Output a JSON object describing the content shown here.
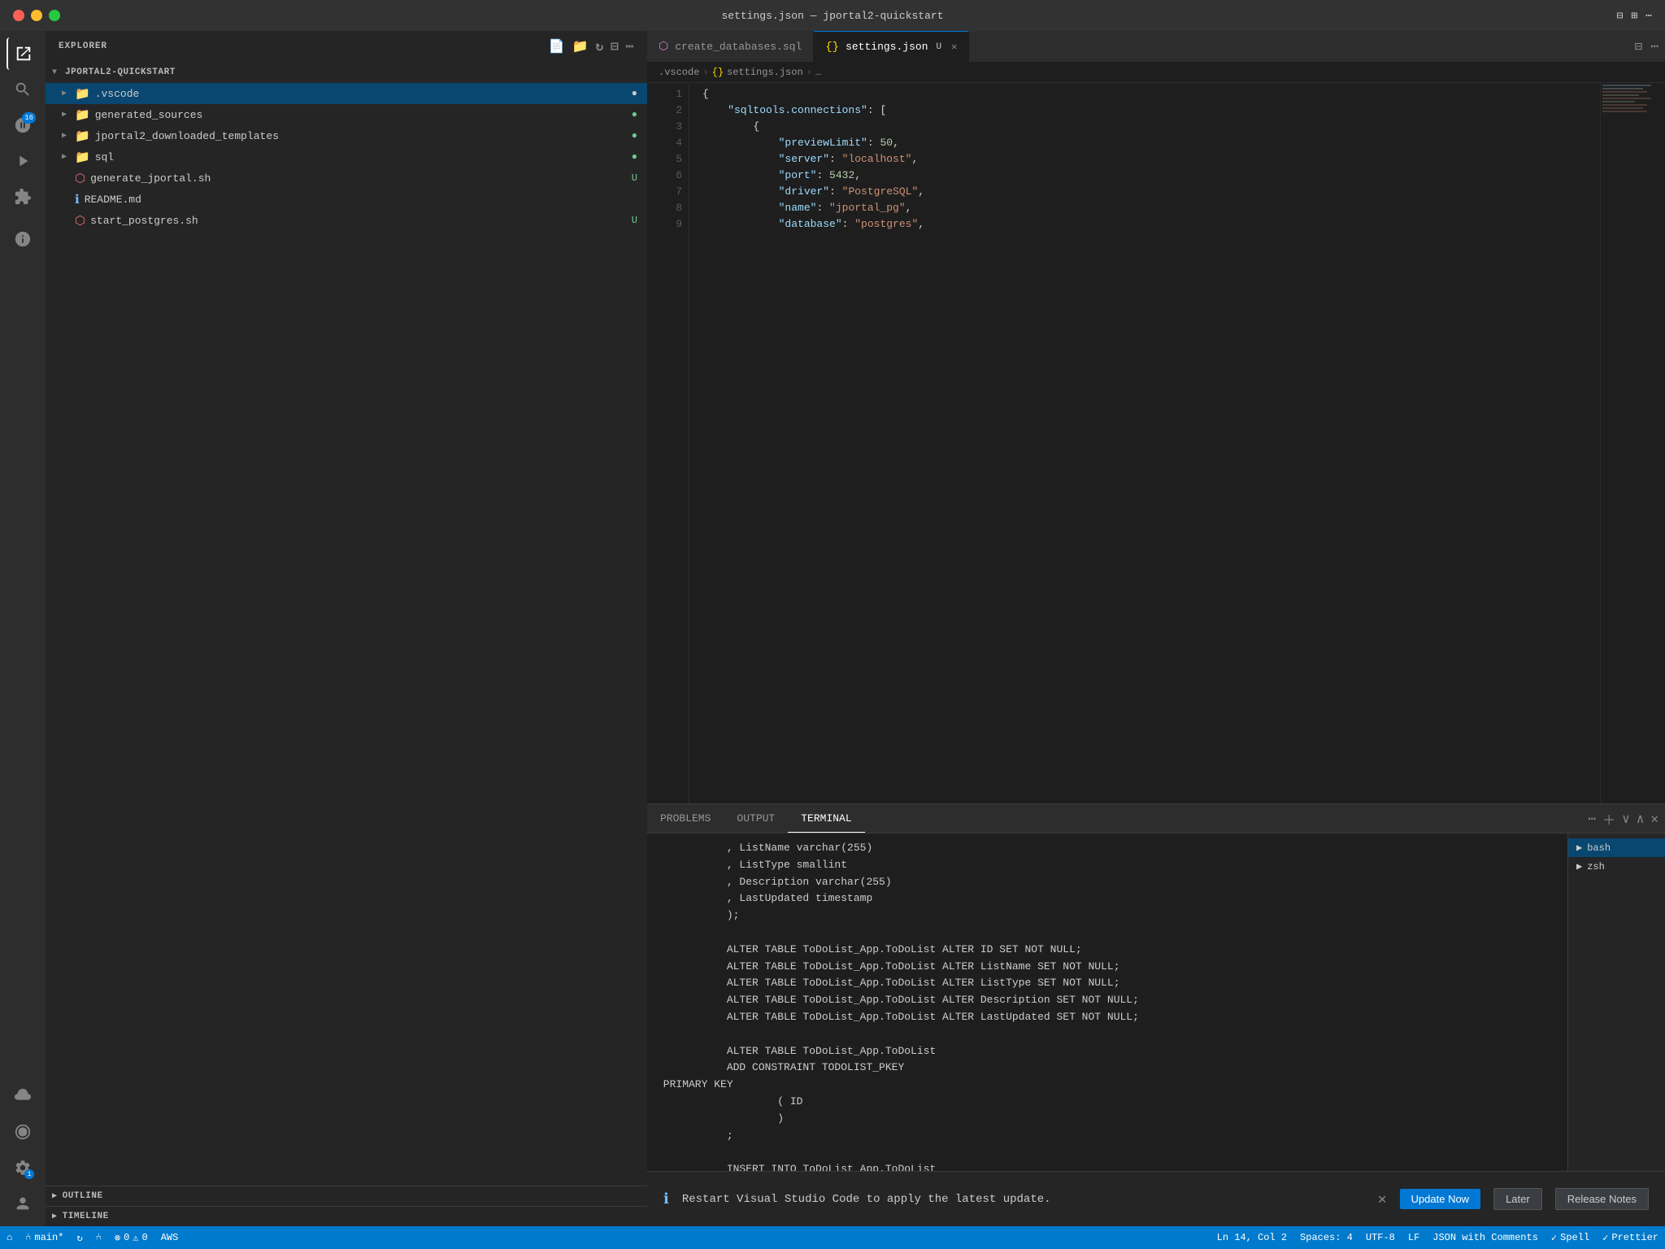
{
  "titlebar": {
    "title": "settings.json — jportal2-quickstart",
    "buttons": {
      "close": "●",
      "minimize": "●",
      "maximize": "●"
    }
  },
  "activity": {
    "icons": [
      {
        "name": "explorer",
        "symbol": "⎘",
        "active": true,
        "badge": null
      },
      {
        "name": "search",
        "symbol": "🔍",
        "active": false,
        "badge": null
      },
      {
        "name": "source-control",
        "symbol": "⑃",
        "active": false,
        "badge": "16"
      },
      {
        "name": "run",
        "symbol": "▷",
        "active": false,
        "badge": null
      },
      {
        "name": "extensions",
        "symbol": "⊞",
        "active": false,
        "badge": null
      }
    ],
    "bottom": [
      {
        "name": "remote",
        "symbol": "⌂"
      },
      {
        "name": "aws",
        "symbol": "☁"
      },
      {
        "name": "git-lens",
        "symbol": "◎"
      },
      {
        "name": "settings",
        "symbol": "⚙",
        "badge": "1"
      },
      {
        "name": "account",
        "symbol": "👤"
      }
    ]
  },
  "sidebar": {
    "header": "Explorer",
    "project": "JPORTAL2-QUICKSTART",
    "tree": [
      {
        "id": "vscode",
        "type": "folder",
        "name": ".vscode",
        "level": 0,
        "expanded": true,
        "selected": true,
        "status": "dot"
      },
      {
        "id": "generated_sources",
        "type": "folder",
        "name": "generated_sources",
        "level": 0,
        "expanded": false,
        "status": "green"
      },
      {
        "id": "jportal2",
        "type": "folder",
        "name": "jportal2_downloaded_templates",
        "level": 0,
        "expanded": false,
        "status": "green"
      },
      {
        "id": "sql",
        "type": "folder",
        "name": "sql",
        "level": 0,
        "expanded": false,
        "status": "green"
      },
      {
        "id": "generate",
        "type": "file",
        "name": "generate_jportal.sh",
        "level": 0,
        "status": "U",
        "fileIcon": "sh"
      },
      {
        "id": "readme",
        "type": "file",
        "name": "README.md",
        "level": 0,
        "status": "",
        "fileIcon": "md"
      },
      {
        "id": "start",
        "type": "file",
        "name": "start_postgres.sh",
        "level": 0,
        "status": "U",
        "fileIcon": "sh"
      }
    ],
    "outline": "OUTLINE",
    "timeline": "TIMELINE"
  },
  "tabs": [
    {
      "id": "create_db",
      "label": "create_databases.sql",
      "active": false,
      "modified": false,
      "icon": "sql"
    },
    {
      "id": "settings",
      "label": "settings.json",
      "active": true,
      "modified": true,
      "icon": "json"
    }
  ],
  "breadcrumb": {
    "path": [
      ".vscode",
      "settings.json",
      "..."
    ]
  },
  "editor": {
    "lines": [
      {
        "num": 1,
        "content": "{"
      },
      {
        "num": 2,
        "content": "    \"sqltools.connections\": ["
      },
      {
        "num": 3,
        "content": "        {"
      },
      {
        "num": 4,
        "content": "            \"previewLimit\": 50,"
      },
      {
        "num": 5,
        "content": "            \"server\": \"localhost\","
      },
      {
        "num": 6,
        "content": "            \"port\": 5432,"
      },
      {
        "num": 7,
        "content": "            \"driver\": \"PostgreSQL\","
      },
      {
        "num": 8,
        "content": "            \"name\": \"jportal_pg\","
      },
      {
        "num": 9,
        "content": "            \"database\": \"postgres\","
      }
    ]
  },
  "terminal": {
    "tabs": [
      "PROBLEMS",
      "OUTPUT",
      "TERMINAL"
    ],
    "active_tab": "TERMINAL",
    "shells": [
      "bash",
      "zsh"
    ],
    "active_shell": "bash",
    "content": [
      "           , ListName varchar(255)",
      "           , ListType smallint",
      "           , Description varchar(255)",
      "           , LastUpdated timestamp",
      "           );",
      "",
      "           ALTER TABLE ToDoList_App.ToDoList ALTER ID SET NOT NULL;",
      "           ALTER TABLE ToDoList_App.ToDoList ALTER ListName SET NOT NULL;",
      "           ALTER TABLE ToDoList_App.ToDoList ALTER ListType SET NOT NULL;",
      "           ALTER TABLE ToDoList_App.ToDoList ALTER Description SET NOT NULL;",
      "           ALTER TABLE ToDoList_App.ToDoList ALTER LastUpdated SET NOT NULL;",
      "",
      "           ALTER TABLE ToDoList_App.ToDoList",
      "           ADD CONSTRAINT TODOLIST_PKEY",
      " PRIMARY KEY",
      "                   ( ID",
      "                   )",
      "           ;",
      "",
      "           INSERT INTO ToDoList_App.ToDoList"
    ]
  },
  "notification": {
    "icon": "ℹ",
    "message": "Restart Visual Studio Code to apply the latest update.",
    "buttons": {
      "update": "Update Now",
      "later": "Later",
      "notes": "Release Notes"
    }
  },
  "statusbar": {
    "branch": "main*",
    "sync": "↻",
    "git_actions": "⑃",
    "errors": "0",
    "warnings": "0",
    "aws": "AWS",
    "position": "Ln 14, Col 2",
    "spaces": "Spaces: 4",
    "encoding": "UTF-8",
    "eol": "LF",
    "language": "JSON with Comments",
    "spell": "Spell",
    "prettier": "Prettier"
  }
}
